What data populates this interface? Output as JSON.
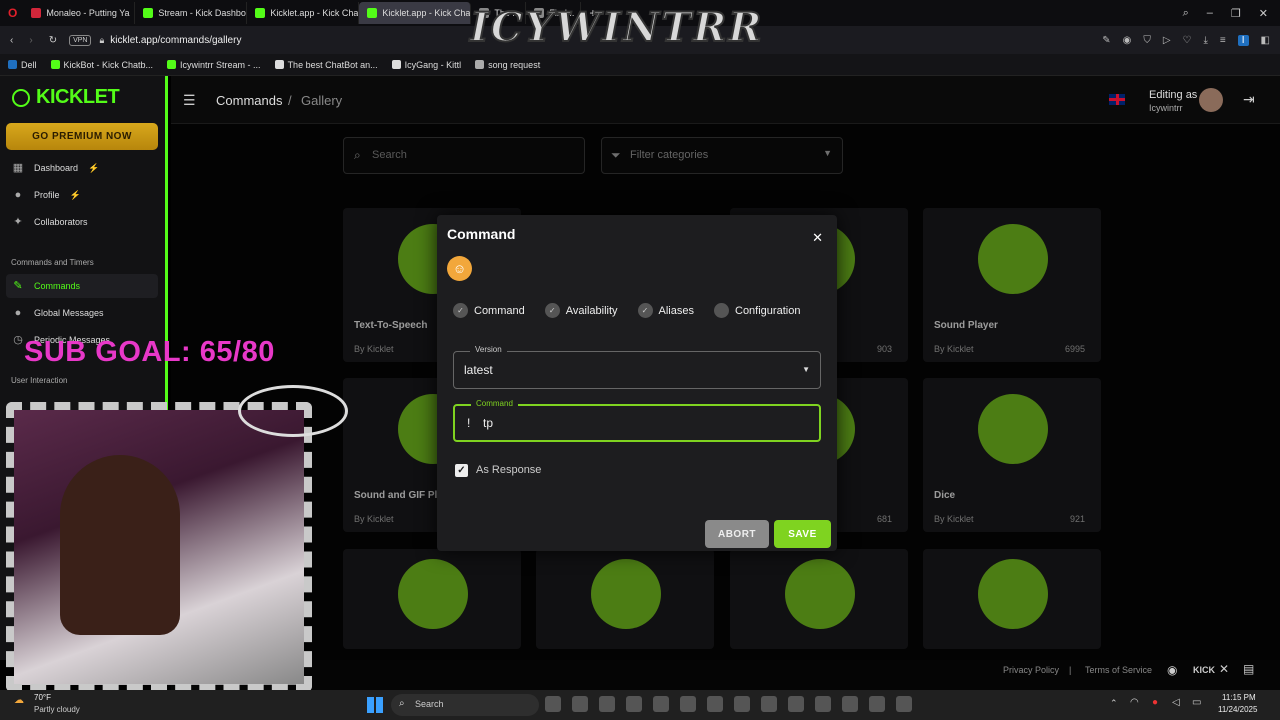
{
  "browser": {
    "tabs": [
      {
        "label": "Monaleo - Putting Ya",
        "color": "#d2263a"
      },
      {
        "label": "Stream - Kick Dashboard",
        "color": "#53fc18"
      },
      {
        "label": "Kicklet.app - Kick Chatbot",
        "color": "#53fc18"
      },
      {
        "label": "Kicklet.app - Kick Chatbot",
        "color": "#53fc18",
        "active": true
      },
      {
        "label": "The ...",
        "color": "#888888"
      },
      {
        "label": "Find...",
        "color": "#888888"
      }
    ],
    "new_tab": "+",
    "vpn_label": "VPN",
    "url": "kicklet.app/commands/gallery",
    "bookmarks": [
      {
        "label": "Dell",
        "color": "#1f6fbf"
      },
      {
        "label": "KickBot - Kick Chatb...",
        "color": "#53fc18"
      },
      {
        "label": "Icywintrr Stream - ...",
        "color": "#53fc18"
      },
      {
        "label": "The best ChatBot an...",
        "color": "#dddddd"
      },
      {
        "label": "IcyGang - Kittl",
        "color": "#dddddd"
      },
      {
        "label": "song request",
        "color": "#aaaaaa"
      }
    ],
    "stream_overlay_title": "ICYWINTRR"
  },
  "sidebar": {
    "logo": "KICKLET",
    "premium_button": "GO PREMIUM NOW",
    "items_top": [
      {
        "label": "Dashboard",
        "icon": "dashboard-icon",
        "glyph": "▦",
        "badge": "⚡"
      },
      {
        "label": "Profile",
        "icon": "profile-icon",
        "glyph": "●",
        "badge": "⚡"
      },
      {
        "label": "Collaborators",
        "icon": "collaborators-icon",
        "glyph": "✦",
        "badge": ""
      }
    ],
    "section_commands": "Commands and Timers",
    "items_commands": [
      {
        "label": "Commands",
        "icon": "wrench-icon",
        "glyph": "✎",
        "active": true
      },
      {
        "label": "Global Messages",
        "icon": "chat-icon",
        "glyph": "●"
      },
      {
        "label": "Periodic Messages",
        "icon": "clock-icon",
        "glyph": "◷"
      }
    ],
    "section_user": "User Interaction"
  },
  "header": {
    "breadcrumb_root": "Commands",
    "breadcrumb_sep": "/",
    "breadcrumb_current": "Gallery",
    "editing_as_label": "Editing as",
    "editing_as_user": "Icywintrr"
  },
  "filters": {
    "search_placeholder": "Search",
    "category_placeholder": "Filter categories"
  },
  "cards_row1": [
    {
      "title": "Text-To-Speech",
      "author": "By Kicklet",
      "downloads": ""
    },
    {
      "title": "",
      "author": "",
      "downloads": "903"
    },
    {
      "title": "Sound Player",
      "author": "By Kicklet",
      "downloads": "6995"
    }
  ],
  "cards_row2": [
    {
      "title": "Sound and GIF Pl...",
      "author": "By Kicklet",
      "downloads": ""
    },
    {
      "title": "",
      "author": "",
      "downloads": "681"
    },
    {
      "title": "Dice",
      "author": "By Kicklet",
      "downloads": "921"
    }
  ],
  "modal": {
    "title": "Command",
    "close": "✕",
    "steps": [
      "Command",
      "Availability",
      "Aliases",
      "Configuration"
    ],
    "version_label": "Version",
    "version_value": "latest",
    "command_label": "Command",
    "command_prefix": "!",
    "command_value": "tp",
    "as_response_label": "As Response",
    "abort_button": "ABORT",
    "save_button": "SAVE",
    "accent_color": "#7fd320"
  },
  "overlay": {
    "sub_goal": "SUB GOAL: 65/80"
  },
  "footer": {
    "privacy": "Privacy Policy",
    "sep": "|",
    "terms": "Terms of Service",
    "kick": "KICK"
  },
  "taskbar": {
    "weather_temp": "70°F",
    "weather_desc": "Partly cloudy",
    "search_placeholder": "Search",
    "time": "11:15 PM",
    "date": "11/24/2025"
  }
}
